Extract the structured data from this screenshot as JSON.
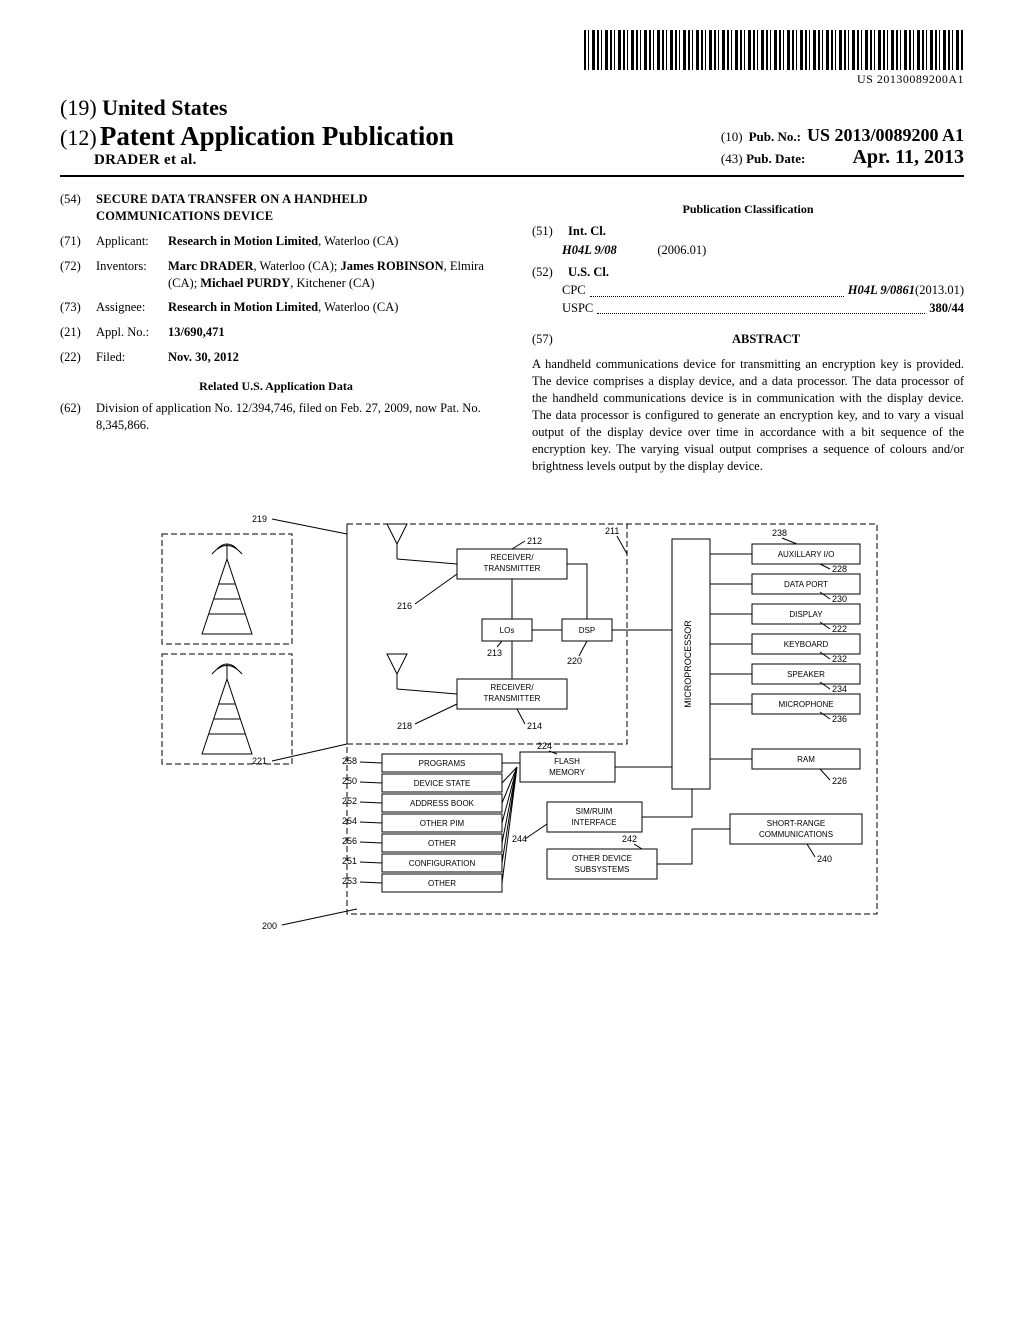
{
  "barcode_number": "US 20130089200A1",
  "header": {
    "country_code": "(19)",
    "country": "United States",
    "doc_type_code": "(12)",
    "doc_type": "Patent Application Publication",
    "authors_line": "DRADER et al.",
    "pubno_code": "(10)",
    "pubno_label": "Pub. No.:",
    "pubno": "US 2013/0089200 A1",
    "pubdate_code": "(43)",
    "pubdate_label": "Pub. Date:",
    "pubdate": "Apr. 11, 2013"
  },
  "left": {
    "title_code": "(54)",
    "title": "SECURE DATA TRANSFER ON A HANDHELD COMMUNICATIONS DEVICE",
    "applicant_code": "(71)",
    "applicant_label": "Applicant:",
    "applicant_name": "Research in Motion Limited",
    "applicant_loc": ", Waterloo (CA)",
    "inventors_code": "(72)",
    "inventors_label": "Inventors:",
    "inventor1_name": "Marc DRADER",
    "inventor1_loc": ", Waterloo (CA); ",
    "inventor2_name": "James ROBINSON",
    "inventor2_loc": ", Elmira (CA); ",
    "inventor3_name": "Michael PURDY",
    "inventor3_loc": ", Kitchener (CA)",
    "assignee_code": "(73)",
    "assignee_label": "Assignee:",
    "assignee_name": "Research in Motion Limited",
    "assignee_loc": ", Waterloo (CA)",
    "applno_code": "(21)",
    "applno_label": "Appl. No.:",
    "applno": "13/690,471",
    "filed_code": "(22)",
    "filed_label": "Filed:",
    "filed": "Nov. 30, 2012",
    "related_head": "Related U.S. Application Data",
    "related_code": "(62)",
    "related_text": "Division of application No. 12/394,746, filed on Feb. 27, 2009, now Pat. No. 8,345,866."
  },
  "right": {
    "class_head": "Publication Classification",
    "intcl_code": "(51)",
    "intcl_label": "Int. Cl.",
    "intcl_class": "H04L 9/08",
    "intcl_date": "(2006.01)",
    "uscl_code": "(52)",
    "uscl_label": "U.S. Cl.",
    "cpc_label": "CPC",
    "cpc_val": "H04L 9/0861",
    "cpc_date": " (2013.01)",
    "uspc_label": "USPC",
    "uspc_val": "380/44",
    "abstract_code": "(57)",
    "abstract_label": "ABSTRACT",
    "abstract": "A handheld communications device for transmitting an encryption key is provided. The device comprises a display device, and a data processor. The data processor of the handheld communications device is in communication with the display device. The data processor is configured to generate an encryption key, and to vary a visual output of the display device over time in accordance with a bit sequence of the encryption key. The varying visual output comprises a sequence of colours and/or brightness levels output by the display device."
  },
  "diagram": {
    "refs": {
      "r219": "219",
      "r221": "221",
      "r200": "200",
      "r212": "212",
      "r216": "216",
      "r213": "213",
      "r218": "218",
      "r214": "214",
      "r211": "211",
      "r220": "220",
      "r224": "224",
      "r244": "244",
      "r242": "242",
      "r238": "238",
      "r228": "228",
      "r230": "230",
      "r222": "222",
      "r232": "232",
      "r234": "234",
      "r236": "236",
      "r226": "226",
      "r240": "240",
      "r258": "258",
      "r250": "250",
      "r252": "252",
      "r254": "254",
      "r256": "256",
      "r251": "251",
      "r253": "253"
    },
    "labels": {
      "rx1": "RECEIVER/",
      "tx": "TRANSMITTER",
      "los": "LOs",
      "dsp": "DSP",
      "micro": "MICROPROCESSOR",
      "auxio": "AUXILLARY I/O",
      "dataport": "DATA PORT",
      "display": "DISPLAY",
      "keyboard": "KEYBOARD",
      "speaker": "SPEAKER",
      "microphone": "MICROPHONE",
      "ram": "RAM",
      "src": "SHORT-RANGE",
      "comm": "COMMUNICATIONS",
      "flash1": "FLASH",
      "flash2": "MEMORY",
      "sim1": "SIM/RUIM",
      "sim2": "INTERFACE",
      "ods1": "OTHER DEVICE",
      "ods2": "SUBSYSTEMS",
      "programs": "PROGRAMS",
      "devstate": "DEVICE STATE",
      "addr": "ADDRESS BOOK",
      "opim": "OTHER PIM",
      "other": "OTHER",
      "config": "CONFIGURATION"
    }
  }
}
